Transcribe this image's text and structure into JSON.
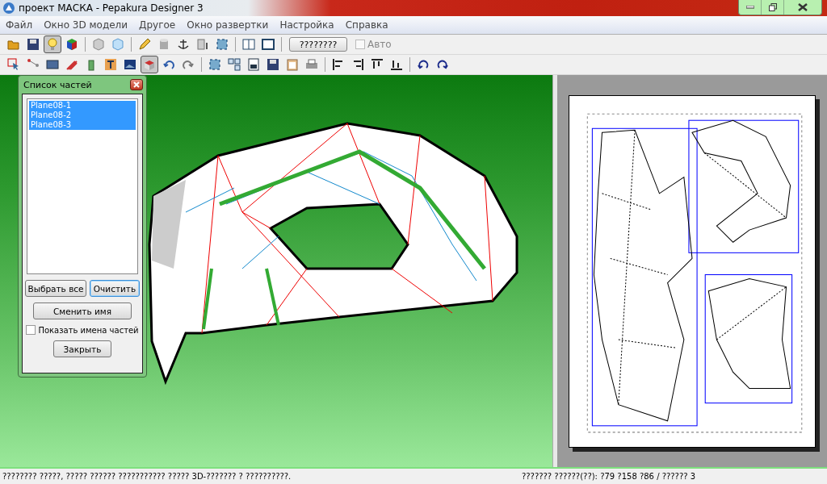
{
  "window": {
    "title": "проект МАСКА - Pepakura Designer 3"
  },
  "menu": [
    "Файл",
    "Окно 3D модели",
    "Другое",
    "Окно развертки",
    "Настройка",
    "Справка"
  ],
  "toolbar_1": {
    "items": [
      {
        "kind": "folder",
        "pressed": false
      },
      {
        "kind": "floppy",
        "pressed": false
      },
      {
        "kind": "bulb",
        "pressed": true
      },
      {
        "kind": "cube",
        "pressed": false
      },
      {
        "kind": "separator"
      },
      {
        "kind": "graycube",
        "pressed": false
      },
      {
        "kind": "bluecube",
        "pressed": false
      },
      {
        "kind": "separator"
      },
      {
        "kind": "pencil",
        "pressed": false
      },
      {
        "kind": "cylinder",
        "pressed": false
      },
      {
        "kind": "anchor",
        "pressed": false
      },
      {
        "kind": "bar",
        "pressed": false
      },
      {
        "kind": "frame",
        "pressed": false
      },
      {
        "kind": "separator"
      },
      {
        "kind": "twopane",
        "pressed": false
      },
      {
        "kind": "pane",
        "pressed": false
      }
    ],
    "button": "????????",
    "checkbox": {
      "label": "Авто",
      "checked": false,
      "disabled": true
    }
  },
  "toolbar_2": {
    "items": [
      {
        "kind": "pointer",
        "pressed": false
      },
      {
        "kind": "nodes",
        "pressed": false
      },
      {
        "kind": "film",
        "pressed": false
      },
      {
        "kind": "crayons",
        "pressed": false
      },
      {
        "kind": "bottle",
        "pressed": false
      },
      {
        "kind": "letter",
        "pressed": false
      },
      {
        "kind": "image",
        "pressed": false
      },
      {
        "kind": "stamp",
        "pressed": true
      },
      {
        "kind": "undo",
        "pressed": false
      },
      {
        "kind": "redo",
        "pressed": false
      },
      {
        "kind": "separator"
      },
      {
        "kind": "frame",
        "pressed": false
      },
      {
        "kind": "grid",
        "pressed": false
      },
      {
        "kind": "page",
        "pressed": false
      },
      {
        "kind": "floppy",
        "pressed": false
      },
      {
        "kind": "clipboard",
        "pressed": false
      },
      {
        "kind": "printer",
        "pressed": false
      },
      {
        "kind": "separator"
      },
      {
        "kind": "alignleft",
        "pressed": false
      },
      {
        "kind": "alignright",
        "pressed": false
      },
      {
        "kind": "aligntop",
        "pressed": false
      },
      {
        "kind": "alignbottom",
        "pressed": false
      },
      {
        "kind": "separator"
      },
      {
        "kind": "rotateleft",
        "pressed": false
      },
      {
        "kind": "rotateright",
        "pressed": false
      }
    ]
  },
  "parts_dialog": {
    "title": "Список частей",
    "parts": [
      {
        "name": "Plane08-1",
        "selected": true
      },
      {
        "name": "Plane08-2",
        "selected": true
      },
      {
        "name": "Plane08-3",
        "selected": true
      }
    ],
    "buttons": [
      {
        "label": "Выбрать все",
        "focused": false
      },
      {
        "label": "Очистить",
        "focused": true
      }
    ],
    "rename_button": "Сменить имя",
    "show_names": {
      "label": "Показать имена частей",
      "checked": false
    },
    "close_button": "Закрыть"
  },
  "status_bar": {
    "left": "???????? ?????, ????? ?????? ??????????? ????? 3D-??????? ? ??????????.",
    "right": "??????? ??????(??): ?79 ?158 ?86 / ?????? 3"
  }
}
